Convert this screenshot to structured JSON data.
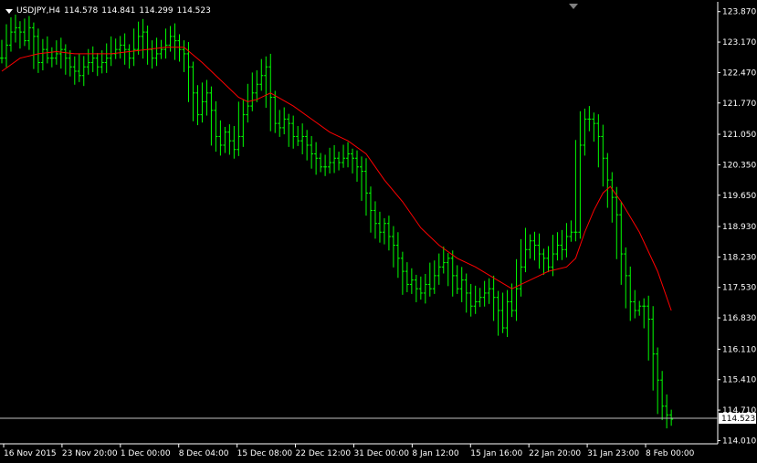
{
  "header": {
    "symbol": "USDJPY,H4",
    "open": "114.578",
    "high": "114.841",
    "low": "114.299",
    "close": "114.523"
  },
  "colors": {
    "background": "#000000",
    "foreground": "#ffffff",
    "bars": "#00ff00",
    "ma": "#ff0000",
    "price_line": "#c0c0c0"
  },
  "chart_data": {
    "type": "line",
    "instrument": "USDJPY",
    "timeframe": "H4",
    "ylim": [
      113.935,
      124.095
    ],
    "y_ticks": [
      "123.870",
      "123.170",
      "122.470",
      "121.770",
      "121.050",
      "120.350",
      "119.650",
      "118.930",
      "118.230",
      "117.530",
      "116.830",
      "116.110",
      "115.410",
      "114.710",
      "114.010"
    ],
    "x_ticks": [
      "16 Nov 2015",
      "23 Nov 20:00",
      "1 Dec 00:00",
      "8 Dec 04:00",
      "15 Dec 08:00",
      "22 Dec 12:00",
      "31 Dec 00:00",
      "8 Jan 12:00",
      "15 Jan 16:00",
      "22 Jan 20:00",
      "31 Jan 23:00",
      "8 Feb 00:00"
    ],
    "current_price": "114.523",
    "series": [
      {
        "chart": "bars",
        "points": [
          [
            0,
            122.8
          ],
          [
            5,
            123.1
          ],
          [
            10,
            123.4
          ],
          [
            15,
            123.5
          ],
          [
            20,
            123.4
          ],
          [
            25,
            123.2
          ],
          [
            30,
            123.5
          ],
          [
            35,
            123.3
          ],
          [
            40,
            122.7
          ],
          [
            45,
            123.0
          ],
          [
            50,
            122.8
          ],
          [
            55,
            122.8
          ],
          [
            60,
            122.9
          ],
          [
            65,
            123.0
          ],
          [
            70,
            122.8
          ],
          [
            75,
            122.6
          ],
          [
            80,
            122.5
          ],
          [
            85,
            122.4
          ],
          [
            90,
            122.6
          ],
          [
            95,
            122.7
          ],
          [
            100,
            122.8
          ],
          [
            105,
            122.6
          ],
          [
            110,
            122.7
          ],
          [
            115,
            122.8
          ],
          [
            120,
            122.9
          ],
          [
            125,
            123.0
          ],
          [
            130,
            123.1
          ],
          [
            135,
            123.0
          ],
          [
            140,
            122.8
          ],
          [
            145,
            123.0
          ],
          [
            150,
            123.3
          ],
          [
            155,
            123.4
          ],
          [
            160,
            123.0
          ],
          [
            165,
            122.8
          ],
          [
            170,
            122.9
          ],
          [
            175,
            123.0
          ],
          [
            180,
            123.1
          ],
          [
            185,
            123.3
          ],
          [
            190,
            123.2
          ],
          [
            195,
            123.0
          ],
          [
            200,
            122.9
          ],
          [
            205,
            122.6
          ],
          [
            210,
            122.0
          ],
          [
            215,
            121.5
          ],
          [
            220,
            121.8
          ],
          [
            225,
            122.0
          ],
          [
            230,
            121.6
          ],
          [
            235,
            121.0
          ],
          [
            240,
            120.8
          ],
          [
            245,
            121.1
          ],
          [
            250,
            120.9
          ],
          [
            255,
            120.7
          ],
          [
            260,
            121.0
          ],
          [
            265,
            121.5
          ],
          [
            270,
            121.7
          ],
          [
            275,
            122.0
          ],
          [
            280,
            122.2
          ],
          [
            285,
            122.4
          ],
          [
            290,
            122.6
          ],
          [
            295,
            121.9
          ],
          [
            300,
            121.3
          ],
          [
            305,
            121.2
          ],
          [
            310,
            121.4
          ],
          [
            315,
            121.3
          ],
          [
            320,
            121.0
          ],
          [
            325,
            120.9
          ],
          [
            330,
            121.0
          ],
          [
            335,
            120.8
          ],
          [
            340,
            120.6
          ],
          [
            345,
            120.5
          ],
          [
            350,
            120.3
          ],
          [
            355,
            120.3
          ],
          [
            360,
            120.4
          ],
          [
            365,
            120.5
          ],
          [
            370,
            120.4
          ],
          [
            375,
            120.5
          ],
          [
            380,
            120.6
          ],
          [
            385,
            120.5
          ],
          [
            390,
            120.3
          ],
          [
            395,
            120.2
          ],
          [
            400,
            119.7
          ],
          [
            405,
            119.3
          ],
          [
            410,
            119.0
          ],
          [
            415,
            118.8
          ],
          [
            420,
            119.0
          ],
          [
            425,
            118.7
          ],
          [
            430,
            118.5
          ],
          [
            435,
            118.2
          ],
          [
            440,
            117.9
          ],
          [
            445,
            117.6
          ],
          [
            450,
            117.7
          ],
          [
            455,
            117.5
          ],
          [
            460,
            117.4
          ],
          [
            465,
            117.6
          ],
          [
            470,
            117.5
          ],
          [
            475,
            117.8
          ],
          [
            480,
            118.0
          ],
          [
            485,
            118.1
          ],
          [
            490,
            118.2
          ],
          [
            495,
            117.8
          ],
          [
            500,
            117.5
          ],
          [
            505,
            117.7
          ],
          [
            510,
            117.4
          ],
          [
            515,
            117.1
          ],
          [
            520,
            117.2
          ],
          [
            525,
            117.3
          ],
          [
            530,
            117.4
          ],
          [
            535,
            117.5
          ],
          [
            540,
            117.3
          ],
          [
            545,
            117.0
          ],
          [
            550,
            116.6
          ],
          [
            555,
            117.2
          ],
          [
            560,
            117.0
          ],
          [
            565,
            117.5
          ],
          [
            570,
            118.0
          ],
          [
            575,
            118.4
          ],
          [
            580,
            118.6
          ],
          [
            585,
            118.5
          ],
          [
            590,
            118.3
          ],
          [
            595,
            118.2
          ],
          [
            600,
            118.0
          ],
          [
            605,
            118.3
          ],
          [
            610,
            118.5
          ],
          [
            615,
            118.4
          ],
          [
            620,
            118.7
          ],
          [
            625,
            118.8
          ],
          [
            630,
            118.8
          ],
          [
            635,
            120.8
          ],
          [
            640,
            121.4
          ],
          [
            645,
            121.4
          ],
          [
            650,
            121.3
          ],
          [
            655,
            121.0
          ],
          [
            660,
            120.5
          ],
          [
            665,
            120.0
          ],
          [
            670,
            119.6
          ],
          [
            675,
            119.2
          ],
          [
            680,
            118.3
          ],
          [
            685,
            117.8
          ],
          [
            690,
            117.2
          ],
          [
            695,
            117.0
          ],
          [
            700,
            117.1
          ],
          [
            705,
            117.1
          ],
          [
            710,
            116.8
          ],
          [
            715,
            116.0
          ],
          [
            720,
            115.4
          ],
          [
            725,
            114.8
          ],
          [
            730,
            114.6
          ],
          [
            735,
            114.5
          ]
        ]
      },
      {
        "chart": "line",
        "points": [
          [
            0,
            122.5
          ],
          [
            20,
            122.8
          ],
          [
            40,
            122.9
          ],
          [
            60,
            122.95
          ],
          [
            80,
            122.9
          ],
          [
            100,
            122.9
          ],
          [
            120,
            122.9
          ],
          [
            140,
            122.95
          ],
          [
            160,
            123.0
          ],
          [
            180,
            123.05
          ],
          [
            200,
            123.05
          ],
          [
            220,
            122.7
          ],
          [
            240,
            122.3
          ],
          [
            260,
            121.9
          ],
          [
            270,
            121.8
          ],
          [
            280,
            121.85
          ],
          [
            295,
            122.0
          ],
          [
            320,
            121.7
          ],
          [
            340,
            121.4
          ],
          [
            360,
            121.1
          ],
          [
            380,
            120.9
          ],
          [
            400,
            120.6
          ],
          [
            420,
            120.0
          ],
          [
            440,
            119.5
          ],
          [
            460,
            118.9
          ],
          [
            480,
            118.5
          ],
          [
            500,
            118.2
          ],
          [
            520,
            118.0
          ],
          [
            540,
            117.75
          ],
          [
            560,
            117.5
          ],
          [
            580,
            117.7
          ],
          [
            600,
            117.9
          ],
          [
            620,
            118.0
          ],
          [
            630,
            118.2
          ],
          [
            640,
            118.8
          ],
          [
            650,
            119.3
          ],
          [
            660,
            119.7
          ],
          [
            668,
            119.85
          ],
          [
            680,
            119.5
          ],
          [
            700,
            118.8
          ],
          [
            720,
            117.9
          ],
          [
            735,
            117.0
          ]
        ]
      }
    ]
  }
}
